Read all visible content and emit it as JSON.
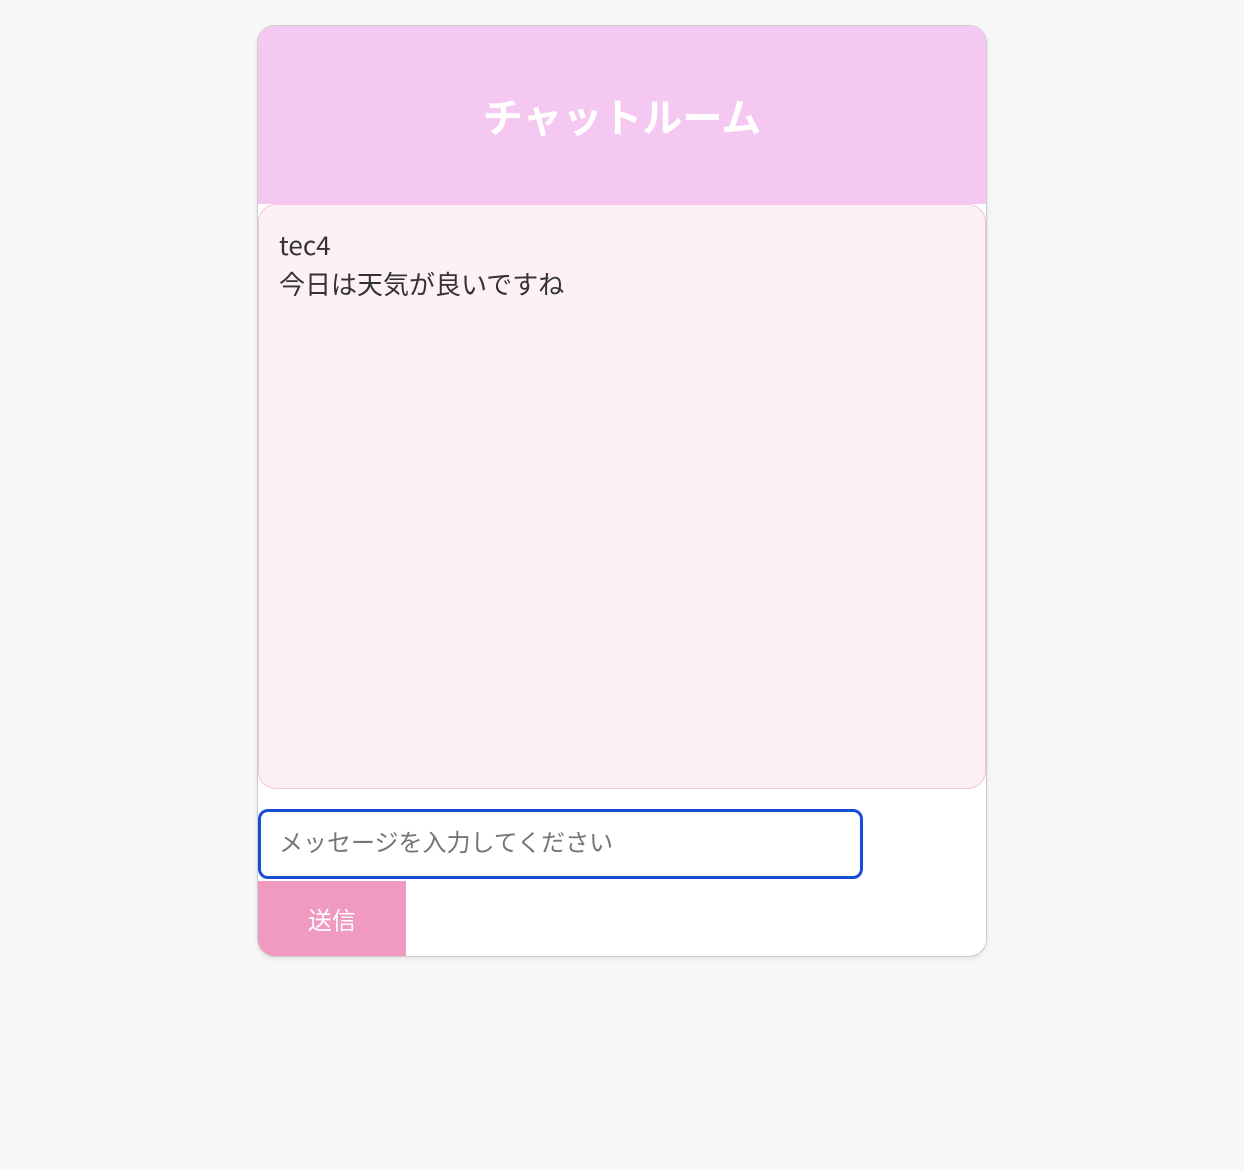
{
  "header": {
    "title": "チャットルーム"
  },
  "messages": [
    {
      "user": "tec4",
      "text": "今日は天気が良いですね"
    }
  ],
  "input": {
    "placeholder": "メッセージを入力してください",
    "value": ""
  },
  "actions": {
    "send_label": "送信"
  },
  "colors": {
    "header_bg": "#f4c8f1",
    "panel_bg": "#fdf1f5",
    "panel_border": "#f5c4d8",
    "input_border": "#1a4dd6",
    "button_bg": "#f19ac1"
  }
}
